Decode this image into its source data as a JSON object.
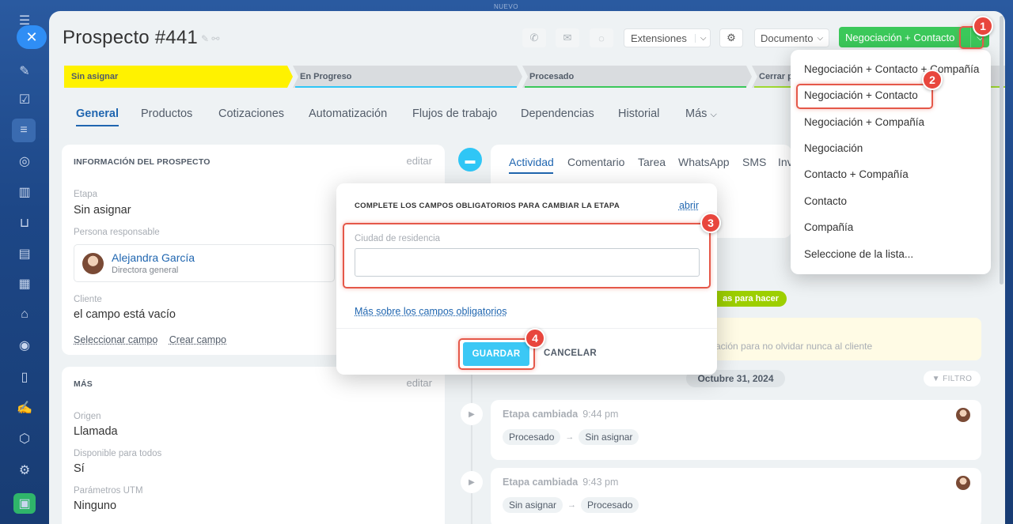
{
  "top_label": "NUEVO",
  "header": {
    "title": "Prospecto #441",
    "extensions_label": "Extensiones",
    "document_label": "Documento",
    "convert_label": "Negociación + Contacto"
  },
  "stages": [
    "Sin asignar",
    "En Progreso",
    "Procesado",
    "Cerrar p"
  ],
  "tabs": [
    "General",
    "Productos",
    "Cotizaciones",
    "Automatización",
    "Flujos de trabajo",
    "Dependencias",
    "Historial",
    "Más"
  ],
  "info_card": {
    "heading": "INFORMACIÓN DEL PROSPECTO",
    "edit": "editar",
    "stage_label": "Etapa",
    "stage_value": "Sin asignar",
    "responsible_label": "Persona responsable",
    "responsible_name": "Alejandra García",
    "responsible_role": "Directora general",
    "client_label": "Cliente",
    "client_value": "el campo está vacío",
    "select_field": "Seleccionar campo",
    "create_field": "Crear campo"
  },
  "more_card": {
    "heading": "MÁS",
    "edit": "editar",
    "source_label": "Origen",
    "source_value": "Llamada",
    "available_label": "Disponible para todos",
    "available_value": "Sí",
    "utm_label": "Parámetros UTM",
    "utm_value": "Ninguno"
  },
  "activity": {
    "tabs": [
      "Actividad",
      "Comentario",
      "Tarea",
      "WhatsApp",
      "SMS",
      "Inv"
    ],
    "todo_badge": "as para hacer",
    "todo_hint": "ación para no olvidar nunca al cliente",
    "date": "Octubre 31, 2024",
    "filter": "FILTRO",
    "events": [
      {
        "title": "Etapa cambiada",
        "time": "9:44 pm",
        "from": "Procesado",
        "to": "Sin asignar"
      },
      {
        "title": "Etapa cambiada",
        "time": "9:43 pm",
        "from": "Sin asignar",
        "to": "Procesado"
      }
    ]
  },
  "modal": {
    "title": "COMPLETE LOS CAMPOS OBLIGATORIOS PARA CAMBIAR LA ETAPA",
    "open_link": "abrir",
    "field_label": "Ciudad de residencia",
    "field_value": "",
    "more_link": "Más sobre los campos obligatorios",
    "save": "GUARDAR",
    "cancel": "CANCELAR"
  },
  "dropdown": {
    "items": [
      "Negociación + Contacto + Compañía",
      "Negociación + Contacto",
      "Negociación + Compañía",
      "Negociación",
      "Contacto + Compañía",
      "Contacto",
      "Compañía",
      "Seleccione de la lista..."
    ]
  },
  "markers": [
    "1",
    "2",
    "3",
    "4"
  ],
  "colors": {
    "accent_green": "#3bc85a",
    "stage_yellow": "#fff200",
    "highlight_red": "#e55849",
    "save_blue": "#3bc8f5",
    "link_blue": "#2066b0"
  }
}
